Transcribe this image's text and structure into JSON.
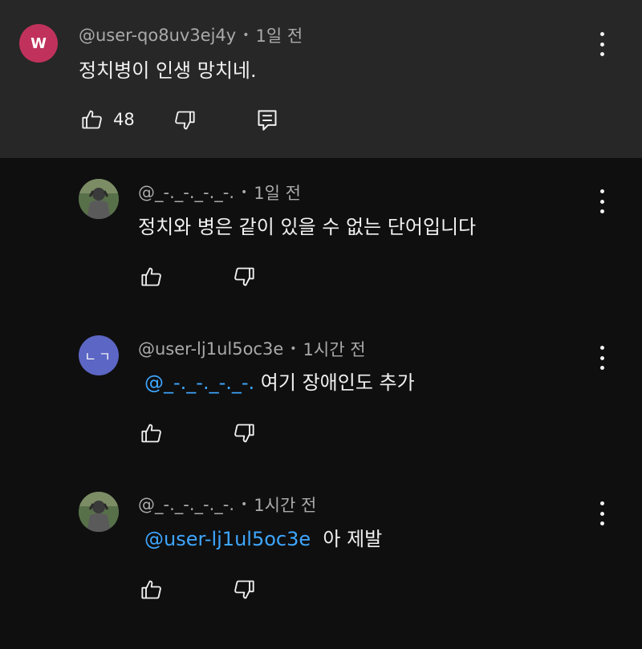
{
  "comments": [
    {
      "avatar_letter": "W",
      "author": "@user-qo8uv3ej4y",
      "time": "1일 전",
      "text": "정치병이 인생 망치네.",
      "likes": "48"
    },
    {
      "author": "@_-._-._-._-.",
      "time": "1일 전",
      "text": "정치와 병은 같이 있을 수 없는 단어입니다"
    },
    {
      "avatar_letters": "ㄴㄱ",
      "author": "@user-lj1ul5oc3e",
      "time": "1시간 전",
      "mention": "@_-._-._-._-.",
      "text": " 여기 장애인도 추가"
    },
    {
      "author": "@_-._-._-._-.",
      "time": "1시간 전",
      "mention": "@user-lj1ul5oc3e",
      "text": "  아 제발"
    }
  ],
  "meta_separator": "•",
  "colors": {
    "background": "#0f0f0f",
    "highlight_background": "#272727",
    "mention": "#3ea6ff",
    "secondary_text": "#aaaaaa"
  },
  "icons": [
    "like-icon",
    "dislike-icon",
    "reply-icon",
    "more-options-icon"
  ]
}
